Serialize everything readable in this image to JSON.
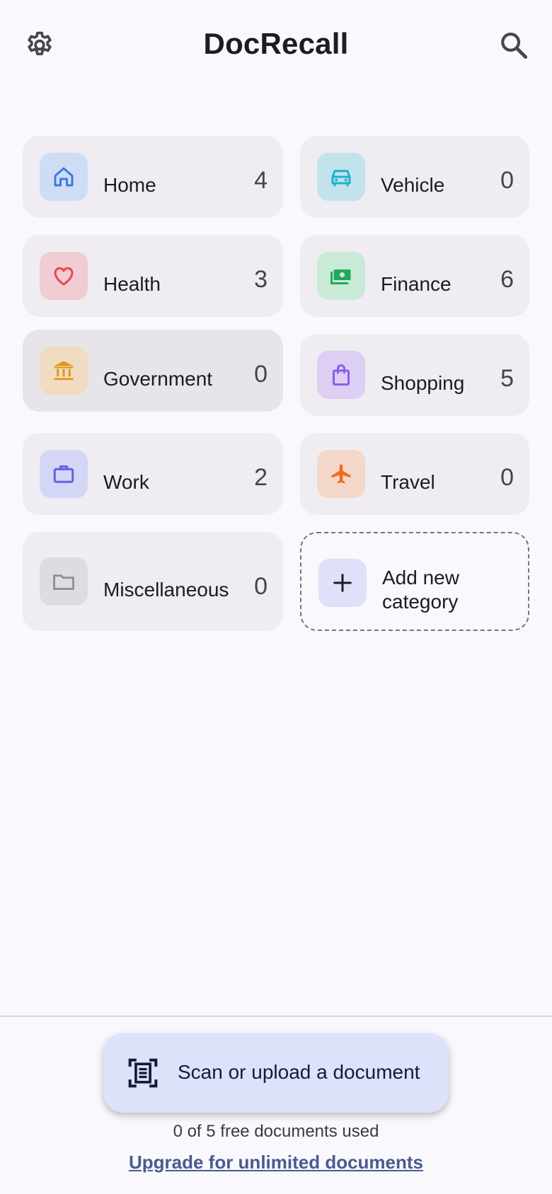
{
  "header": {
    "title": "DocRecall"
  },
  "categories": [
    {
      "label": "Home",
      "count": "4",
      "icon": "home-icon",
      "tint": "#cfdcf6",
      "color": "#3a7be0"
    },
    {
      "label": "Vehicle",
      "count": "0",
      "icon": "car-icon",
      "tint": "#c3e3ec",
      "color": "#1ab3cf"
    },
    {
      "label": "Health",
      "count": "3",
      "icon": "heart-icon",
      "tint": "#f2ccd3",
      "color": "#e5484d"
    },
    {
      "label": "Finance",
      "count": "6",
      "icon": "money-icon",
      "tint": "#c9ead7",
      "color": "#22a95a"
    },
    {
      "label": "Government",
      "count": "0",
      "icon": "bank-icon",
      "tint": "#f0dcc0",
      "color": "#e0951a"
    },
    {
      "label": "Shopping",
      "count": "5",
      "icon": "shopping-bag-icon",
      "tint": "#dccff3",
      "color": "#8b5cf0"
    },
    {
      "label": "Work",
      "count": "2",
      "icon": "briefcase-icon",
      "tint": "#d4d6f5",
      "color": "#5c63e6"
    },
    {
      "label": "Travel",
      "count": "0",
      "icon": "airplane-icon",
      "tint": "#f3d7c8",
      "color": "#f26b1d"
    },
    {
      "label": "Miscellaneous",
      "count": "0",
      "icon": "folder-icon",
      "tint": "#dcdde2",
      "color": "#8b8c95"
    }
  ],
  "add_category": {
    "label": "Add new category"
  },
  "scan": {
    "label": "Scan or upload a document"
  },
  "usage_text": "0 of 5 free documents used",
  "upgrade_text": "Upgrade for unlimited documents"
}
